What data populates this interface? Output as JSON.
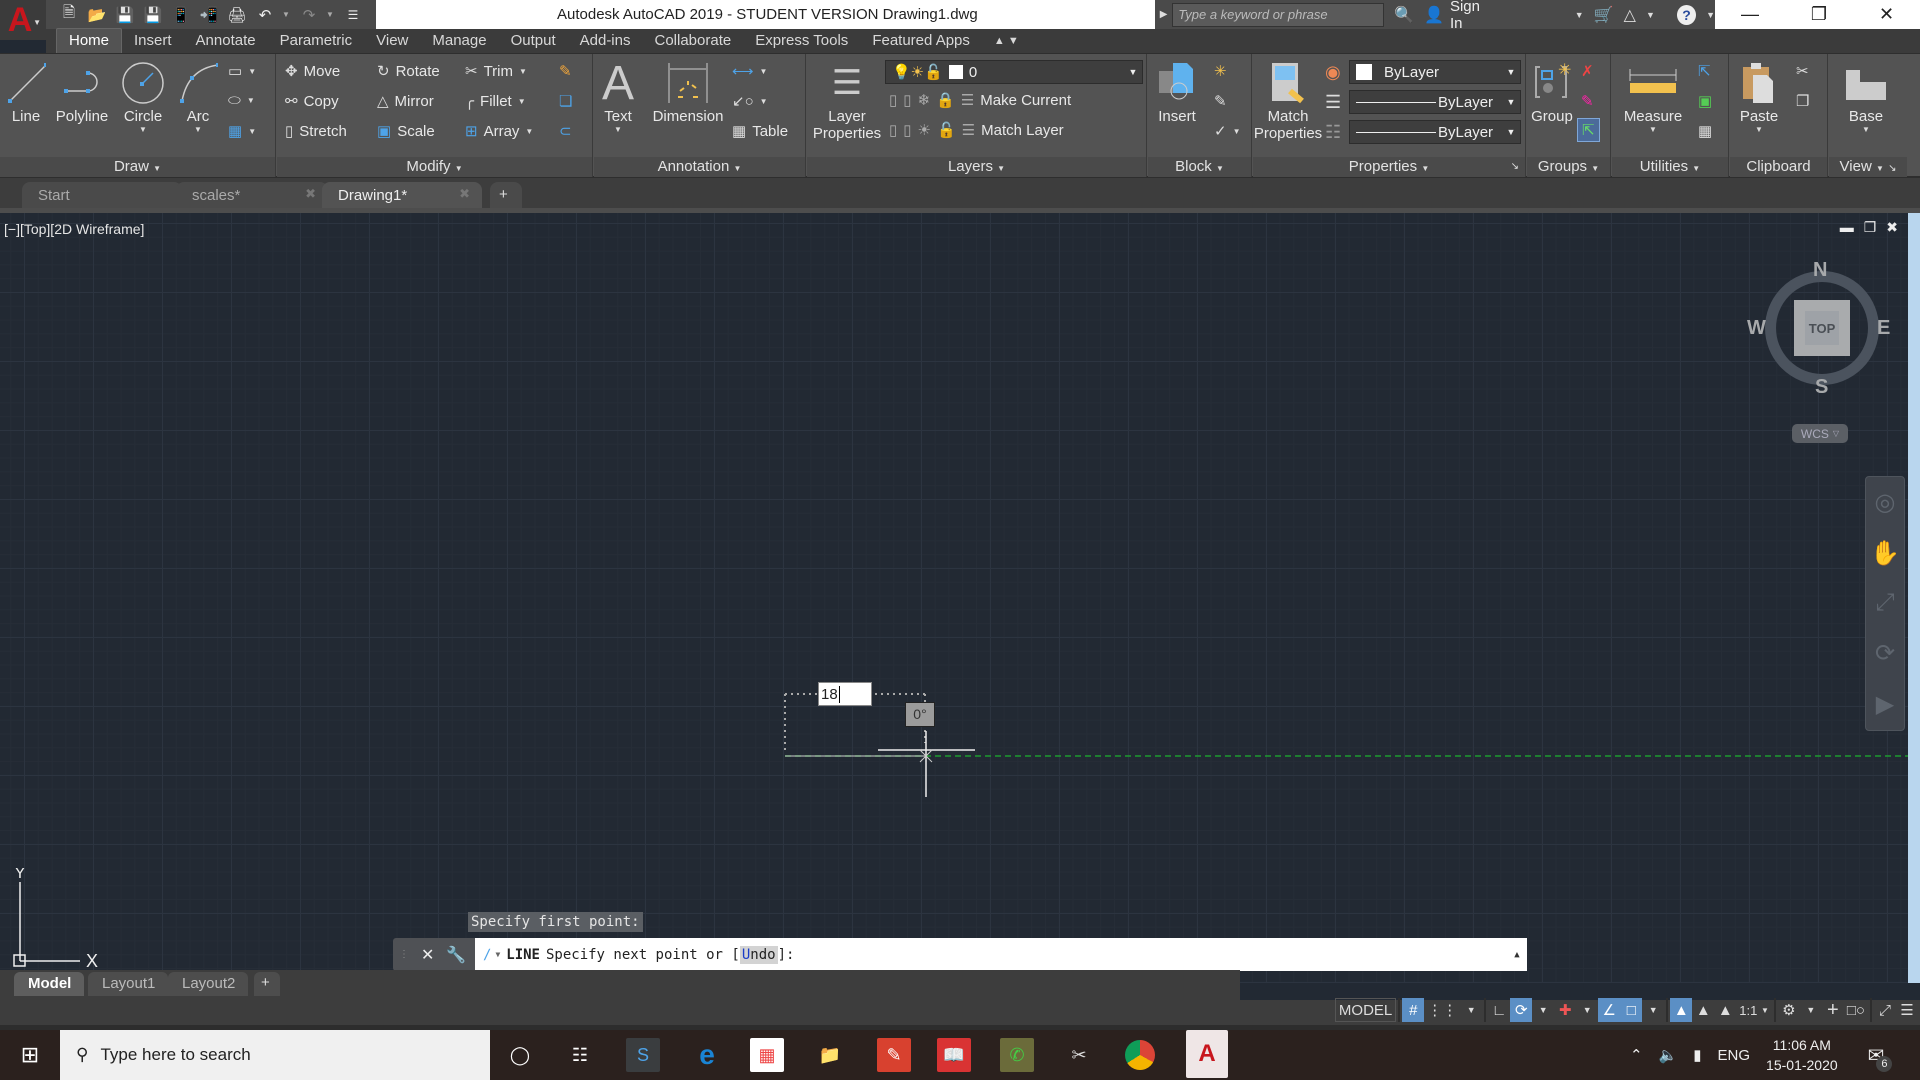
{
  "app": {
    "title": "Autodesk AutoCAD 2019 - STUDENT VERSION    Drawing1.dwg",
    "app_button_logo": "A",
    "search_placeholder": "Type a keyword or phrase",
    "sign_in": "Sign In",
    "qat_icons": [
      "new-icon",
      "open-icon",
      "save-icon",
      "save-as-icon",
      "open-from-web-icon",
      "save-to-web-icon",
      "plot-icon",
      "undo-icon",
      "redo-icon",
      "customize-qat-icon"
    ]
  },
  "ribbon_tabs": [
    "Home",
    "Insert",
    "Annotate",
    "Parametric",
    "View",
    "Manage",
    "Output",
    "Add-ins",
    "Collaborate",
    "Express Tools",
    "Featured Apps"
  ],
  "active_ribbon_tab": "Home",
  "panels": {
    "draw": {
      "title": "Draw",
      "line": "Line",
      "polyline": "Polyline",
      "circle": "Circle",
      "arc": "Arc"
    },
    "modify": {
      "title": "Modify",
      "move": "Move",
      "rotate": "Rotate",
      "trim": "Trim",
      "copy": "Copy",
      "mirror": "Mirror",
      "fillet": "Fillet",
      "stretch": "Stretch",
      "scale": "Scale",
      "array": "Array"
    },
    "annotation": {
      "title": "Annotation",
      "text": "Text",
      "dimension": "Dimension",
      "table": "Table"
    },
    "layers": {
      "title": "Layers",
      "layer_properties_1": "Layer",
      "layer_properties_2": "Properties",
      "current_layer": "0",
      "make_current": "Make Current",
      "match_layer": "Match Layer"
    },
    "block": {
      "title": "Block",
      "insert": "Insert"
    },
    "properties": {
      "title": "Properties",
      "match_1": "Match",
      "match_2": "Properties",
      "color": "ByLayer",
      "lineweight": "ByLayer",
      "linetype": "ByLayer"
    },
    "groups": {
      "title": "Groups",
      "group": "Group"
    },
    "utilities": {
      "title": "Utilities",
      "measure": "Measure"
    },
    "clipboard": {
      "title": "Clipboard",
      "paste": "Paste"
    },
    "view": {
      "title": "View",
      "base": "Base"
    }
  },
  "doc_tabs": [
    {
      "label": "Start",
      "active": false
    },
    {
      "label": "scales*",
      "active": false
    },
    {
      "label": "Drawing1*",
      "active": true
    }
  ],
  "viewport": {
    "label": "[−][Top][2D Wireframe]",
    "viewcube": {
      "face": "TOP",
      "n": "N",
      "s": "S",
      "e": "E",
      "w": "W",
      "ucs": "WCS"
    },
    "ucs_x": "X",
    "ucs_y": "Y",
    "dynamic_input_value": "18",
    "angle_tooltip": "0°"
  },
  "command": {
    "history": "Specify first point:",
    "keyword": "LINE",
    "prompt": "Specify next point or [",
    "option_hotkey": "U",
    "option_rest": "ndo",
    "prompt_end": "]:"
  },
  "layout_tabs": [
    {
      "label": "Model",
      "active": true
    },
    {
      "label": "Layout1",
      "active": false
    },
    {
      "label": "Layout2",
      "active": false
    }
  ],
  "status": {
    "model": "MODEL",
    "scale": "1:1",
    "toggles": {
      "grid": true,
      "snap": false,
      "ortho": false,
      "polar": true,
      "osnap_tracking": false,
      "lineweight": true,
      "osnap": true,
      "annotation_visibility": true
    }
  },
  "taskbar": {
    "search_placeholder": "Type here to search",
    "language": "ENG",
    "time": "11:06 AM",
    "date": "15-01-2020",
    "notifications": "6"
  },
  "colors": {
    "autocad_red": "#c8161d",
    "status_active": "#5b8fc5",
    "viewport_bg": "#222933",
    "polar_track": "#1d9b2f"
  }
}
